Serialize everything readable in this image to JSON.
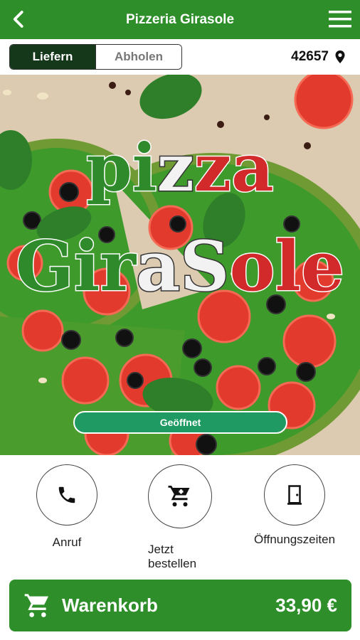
{
  "header": {
    "title": "Pizzeria Girasole"
  },
  "mode": {
    "deliver_label": "Liefern",
    "pickup_label": "Abholen",
    "selected": "Liefern"
  },
  "location": {
    "postcode": "42657"
  },
  "hero": {
    "logo_line1": [
      "pi",
      "z",
      "za"
    ],
    "logo_line2": [
      "Gi",
      "r",
      "a",
      "S",
      "ole"
    ],
    "status": "Geöffnet"
  },
  "actions": [
    {
      "label": "Anruf",
      "icon": "phone-icon"
    },
    {
      "label": "Jetzt bestellen",
      "icon": "cart-icon"
    },
    {
      "label": "Öffnungszeiten",
      "icon": "door-icon"
    }
  ],
  "cart": {
    "label": "Warenkorb",
    "total": "33,90 €"
  },
  "colors": {
    "primary_green": "#2e8f2a",
    "toggle_active": "#16381a",
    "status_green": "#1f9a62"
  }
}
